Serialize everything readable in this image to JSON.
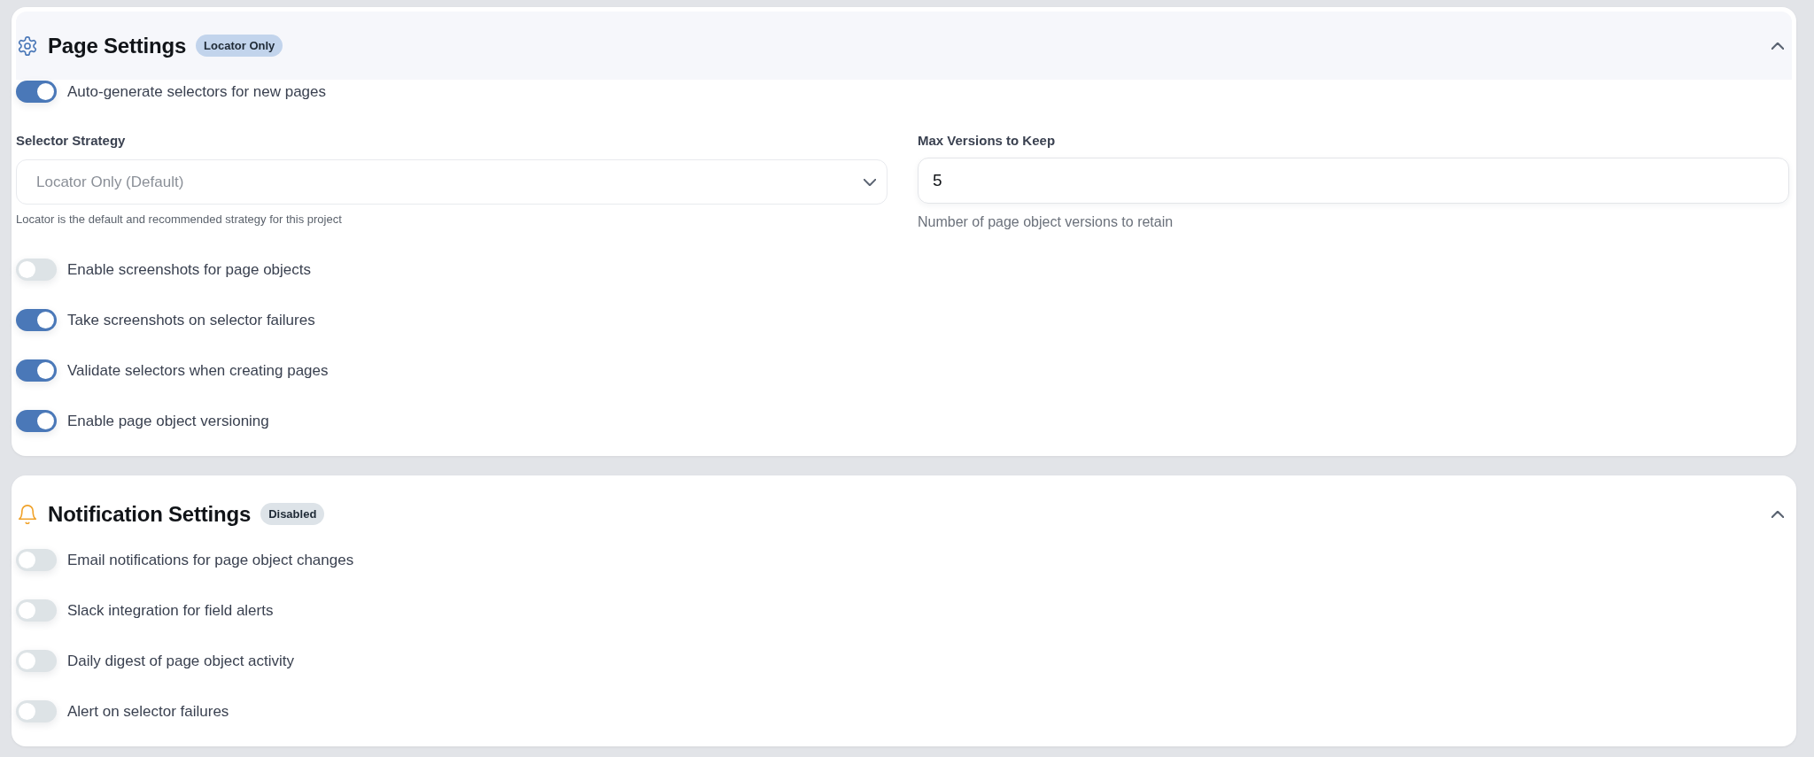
{
  "sections": [
    {
      "kind": "page",
      "title": "Page Settings",
      "badge": {
        "text": "Locator Only",
        "color": "#c2d4ec"
      },
      "expanded": true,
      "hovered": true,
      "items": [
        {
          "kind": "toggle",
          "label": "Auto-generate selectors for new pages",
          "on": true
        },
        {
          "kind": "fields",
          "fields": [
            {
              "kind": "select",
              "label": "Selector Strategy",
              "value": "Locator Only (Default)",
              "disabled": true,
              "help": "Locator is the default and recommended strategy for this project"
            },
            {
              "kind": "number",
              "label": "Max Versions to Keep",
              "value": "5",
              "help": "Number of page object versions to retain"
            }
          ]
        },
        {
          "kind": "toggle",
          "label": "Enable screenshots for page objects",
          "on": false
        },
        {
          "kind": "toggle",
          "label": "Take screenshots on selector failures",
          "on": true
        },
        {
          "kind": "toggle",
          "label": "Validate selectors when creating pages",
          "on": true
        },
        {
          "kind": "toggle",
          "label": "Enable page object versioning",
          "on": true
        }
      ]
    },
    {
      "kind": "notifications",
      "title": "Notification Settings",
      "badge": {
        "text": "Disabled",
        "color": "#dde3e8"
      },
      "expanded": true,
      "hovered": false,
      "items": [
        {
          "kind": "toggle",
          "label": "Email notifications for page object changes",
          "on": false
        },
        {
          "kind": "toggle",
          "label": "Slack integration for field alerts",
          "on": false
        },
        {
          "kind": "toggle",
          "label": "Daily digest of page object activity",
          "on": false
        },
        {
          "kind": "toggle",
          "label": "Alert on selector failures",
          "on": false
        }
      ]
    }
  ]
}
